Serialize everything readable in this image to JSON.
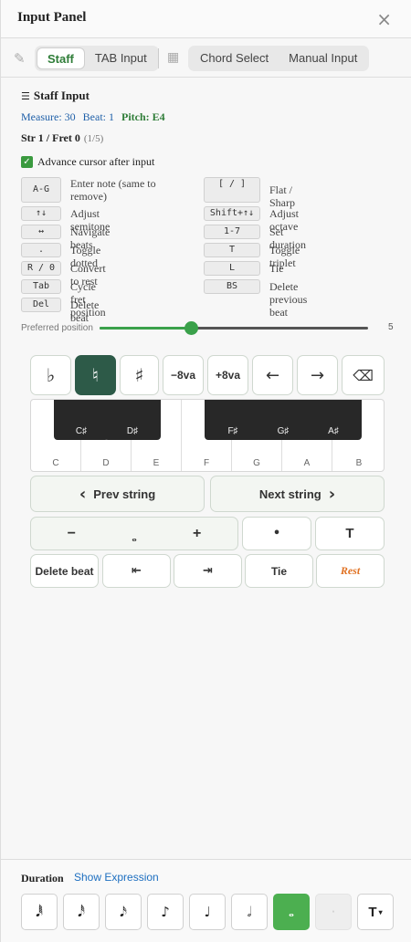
{
  "header": {
    "title": "Input Panel",
    "close_icon": "×"
  },
  "modes": {
    "left": [
      "Staff",
      "TAB Input"
    ],
    "right": [
      "Chord Select",
      "Manual Input"
    ],
    "active": "Staff"
  },
  "staff": {
    "title": "Staff Input",
    "measure": "Measure: 30",
    "beat": "Beat: 1",
    "pitch": "Pitch: E4",
    "str_fret": "Str 1 / Fret 0",
    "str_fret_sub": "(1/5)",
    "advance_label": "Advance cursor after input",
    "advance_checked": true
  },
  "shortcuts": {
    "left": [
      {
        "key": "A-G",
        "desc": "Enter note (same to remove)"
      },
      {
        "key": "↑↓",
        "desc": "Adjust semitone"
      },
      {
        "key": "↔",
        "desc": "Navigate beats"
      },
      {
        "key": ".",
        "desc": "Toggle dotted"
      },
      {
        "key": "R / 0",
        "desc": "Convert to rest"
      },
      {
        "key": "Tab",
        "desc": "Cycle fret position"
      },
      {
        "key": "Del",
        "desc": "Delete beat"
      }
    ],
    "right": [
      {
        "key": "[ / ]",
        "desc": "Flat / Sharp"
      },
      {
        "key": "Shift+↑↓",
        "desc": "Adjust octave"
      },
      {
        "key": "1-7",
        "desc": "Set duration"
      },
      {
        "key": "T",
        "desc": "Toggle triplet"
      },
      {
        "key": "L",
        "desc": "Tie"
      },
      {
        "key": "BS",
        "desc": "Delete previous beat"
      }
    ]
  },
  "preferred": {
    "label": "Preferred position",
    "value": "5",
    "fraction": 0.34
  },
  "accidentals": [
    "♭",
    "♮",
    "♯",
    "−8va",
    "+8va",
    "←",
    "→",
    "⌫"
  ],
  "accidental_active_index": 1,
  "piano": {
    "white": [
      "C",
      "D",
      "E",
      "F",
      "G",
      "A",
      "B"
    ],
    "black": [
      "C♯",
      "D♯",
      "F♯",
      "G♯",
      "A♯"
    ]
  },
  "nav": {
    "prev": "Prev string",
    "next": "Next string",
    "prev_icon": "‹",
    "next_icon": "›"
  },
  "duration_row": {
    "minus": "−",
    "note_glyph": "𝅝",
    "plus": "+",
    "dot": "•",
    "triplet": "T"
  },
  "actions": {
    "delete_beat": "Delete beat",
    "left_tab": "⇤",
    "right_tab": "⇥",
    "tie": "Tie",
    "rest": "Rest"
  },
  "footer": {
    "label": "Duration",
    "expression": "Show Expression",
    "durations": [
      "𝅘𝅥𝅱",
      "𝅘𝅥𝅰",
      "𝅘𝅥𝅯",
      "♪",
      "♩",
      "𝅗𝅥",
      "𝅝",
      "·",
      "T"
    ],
    "active_index": 6,
    "disabled_index": 7
  }
}
